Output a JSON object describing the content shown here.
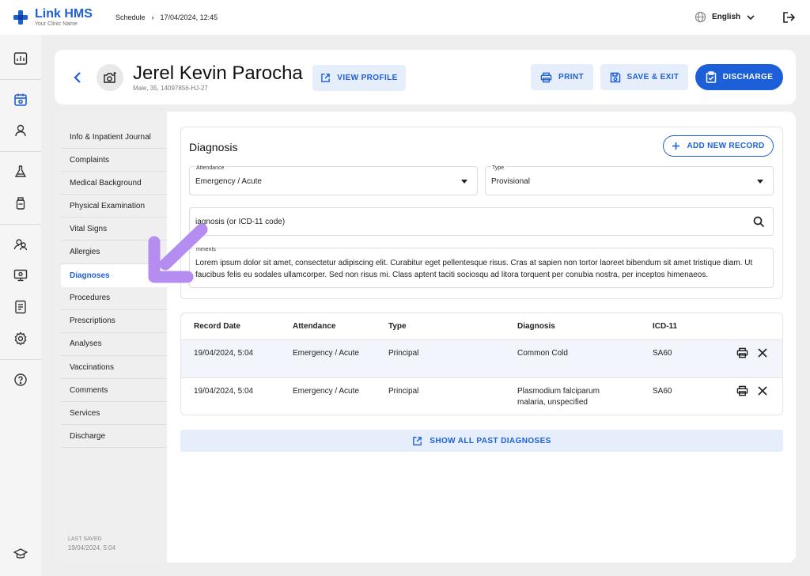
{
  "brand": {
    "title": "Link HMS",
    "subtitle": "Your Clinic Name"
  },
  "breadcrumb": {
    "items": [
      "Schedule",
      "17/04/2024, 12:45"
    ],
    "separator": "›"
  },
  "language": {
    "label": "English"
  },
  "patient": {
    "name": "Jerel Kevin Parocha",
    "meta": "Male, 35, 14097856-HJ-27"
  },
  "header_actions": {
    "view_profile": "VIEW PROFILE",
    "print": "PRINT",
    "save_exit": "SAVE & EXIT",
    "discharge": "DISCHARGE"
  },
  "nav": {
    "items": [
      {
        "label": "Info & Inpatient Journal"
      },
      {
        "label": "Complaints"
      },
      {
        "label": "Medical Background"
      },
      {
        "label": "Physical Examination"
      },
      {
        "label": "Vital Signs"
      },
      {
        "label": "Allergies"
      },
      {
        "label": "Diagnoses",
        "active": true
      },
      {
        "label": "Procedures"
      },
      {
        "label": "Prescriptions"
      },
      {
        "label": "Analyses"
      },
      {
        "label": "Vaccinations"
      },
      {
        "label": "Comments"
      },
      {
        "label": "Services"
      },
      {
        "label": "Discharge"
      }
    ],
    "last_saved_label": "LAST SAVED",
    "last_saved_value": "19/04/2024, 5:04"
  },
  "diagnosis_form": {
    "title": "Diagnosis",
    "add_button": "ADD NEW RECORD",
    "attendance": {
      "label": "Attendance",
      "value": "Emergency / Acute"
    },
    "type": {
      "label": "Type",
      "value": "Provisional"
    },
    "search": {
      "value": "iagnosis (or ICD-11 code)"
    },
    "comments": {
      "label": "mments",
      "value": "Lorem ipsum dolor sit amet, consectetur adipiscing elit. Curabitur eget pellentesque risus. Cras at sapien non tortor laoreet bibendum sit amet tristique diam. Ut faucibus felis eu sodales ullamcorper. Sed non risus mi. Class aptent taciti sociosqu ad litora torquent per conubia nostra, per inceptos himenaeos."
    }
  },
  "records": {
    "columns": [
      "Record Date",
      "Attendance",
      "Type",
      "Diagnosis",
      "ICD-11"
    ],
    "rows": [
      {
        "date": "19/04/2024, 5:04",
        "attendance": "Emergency / Acute",
        "type": "Principal",
        "diagnosis": "Common Cold",
        "icd": "SA60"
      },
      {
        "date": "19/04/2024, 5:04",
        "attendance": "Emergency / Acute",
        "type": "Principal",
        "diagnosis": "Plasmodium falciparum malaria, unspecified",
        "icd": "SA60"
      }
    ]
  },
  "show_all": {
    "label": "SHOW ALL PAST DIAGNOSES"
  },
  "colors": {
    "primary": "#1d5fd8",
    "primary_light": "#e6eefb",
    "hint_arrow": "#b58cf0",
    "row_highlight": "#f2f5fb"
  },
  "icons": {
    "rail": [
      "dashboard-icon",
      "calendar-icon",
      "user-icon",
      "flask-icon",
      "bottle-icon",
      "users-icon",
      "monitor-icon",
      "report-icon",
      "settings-icon",
      "help-icon",
      "graduation-cap-icon"
    ]
  }
}
